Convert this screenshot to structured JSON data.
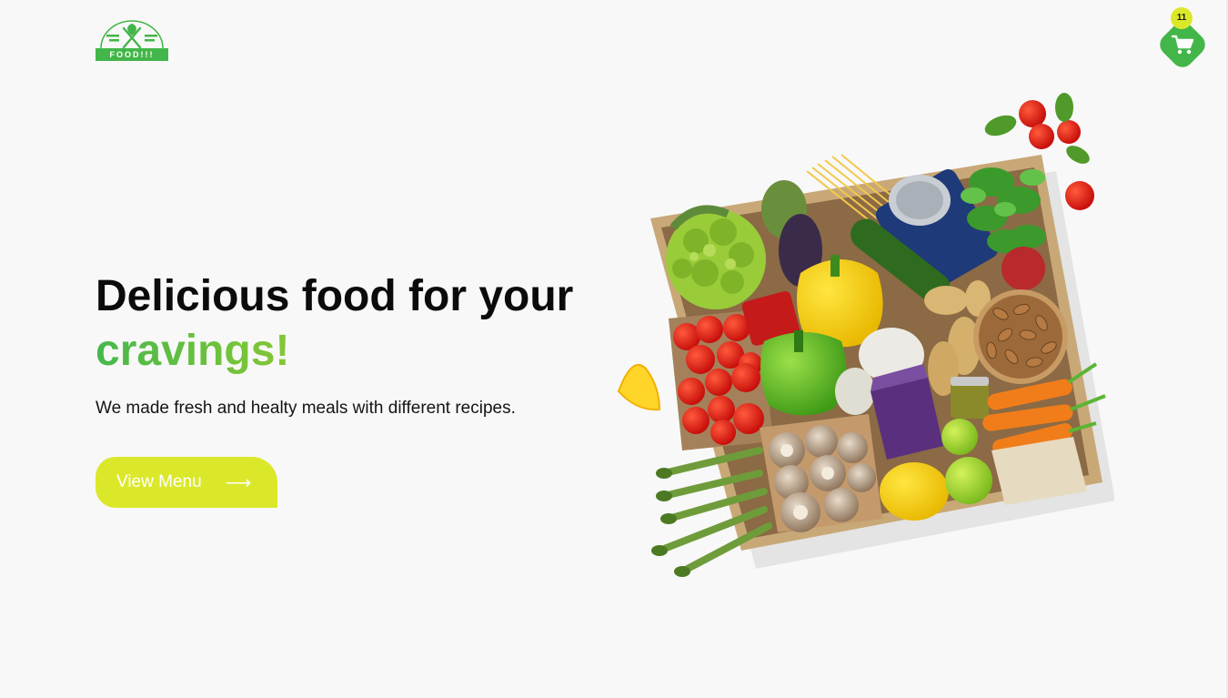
{
  "header": {
    "logo_text": "FOOD!!!",
    "cart_count": "11"
  },
  "hero": {
    "title_line1": "Delicious food for your",
    "title_line2": "cravings!",
    "subtitle": "We made fresh and healty meals with different recipes.",
    "cta_label": "View Menu",
    "cta_arrow": "⟶"
  },
  "colors": {
    "brand_green": "#43b649",
    "accent_yellow": "#dbe82a",
    "background": "#f8f8f8"
  },
  "icons": [
    "fork-knife-icon",
    "cart-icon",
    "arrow-right-icon"
  ]
}
